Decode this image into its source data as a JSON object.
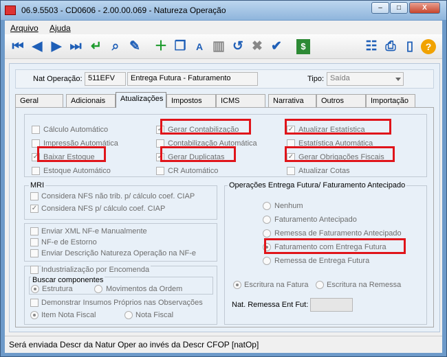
{
  "window": {
    "title": "06.9.5503 - CD0606 - 2.00.00.069 - Natureza Operação",
    "min": "–",
    "max": "□",
    "close": "X"
  },
  "menu": {
    "arquivo": "Arquivo",
    "ajuda": "Ajuda"
  },
  "toolbar": {
    "icons": [
      "first-icon",
      "prev-icon",
      "next-icon",
      "last-icon",
      "enter-icon",
      "zoom-icon",
      "document-edit-icon",
      "new-icon",
      "copy-icon",
      "text-edit-icon",
      "trash-icon",
      "undo-icon",
      "cancel-icon",
      "confirm-icon",
      "dollar-icon",
      "hierarchy-icon",
      "print-icon",
      "exit-icon",
      "help-icon"
    ],
    "dollar": "$",
    "help": "?"
  },
  "header": {
    "nat_label": "Nat Operação:",
    "nat_code": "511EFV",
    "nat_desc": "Entrega Futura - Faturamento",
    "tipo_label": "Tipo:",
    "tipo_value": "Saída"
  },
  "tabs": [
    "Geral",
    "Adicionais",
    "Atualizações",
    "Impostos",
    "ICMS",
    "Narrativa",
    "Outros",
    "Importação"
  ],
  "updates": {
    "calculo": "Cálculo Automático",
    "impressao": "Impressão Automática",
    "baixar": "Baixar Estoque",
    "estoque_auto": "Estoque Automático",
    "gerar_contab": "Gerar Contabilização",
    "contab_auto": "Contabilização Automática",
    "gerar_dup": "Gerar Duplicatas",
    "cr_auto": "CR Automático",
    "atual_estat": "Atualizar Estatística",
    "estat_auto": "Estatística Automática",
    "gerar_obrig": "Gerar Obrigações Fiscais",
    "atual_cotas": "Atualizar Cotas"
  },
  "mri": {
    "title": "MRI",
    "nfs_nao": "Considera NFS não trib. p/ cálculo coef. CIAP",
    "nfs": "Considera NFS p/ cálculo coef. CIAP"
  },
  "nfe": {
    "xml": "Enviar XML NF-e Manualmente",
    "estorno": "NF-e de Estorno",
    "descricao": "Enviar Descrição Natureza Operação na NF-e"
  },
  "indus": {
    "title": "Industrialização por Encomenda",
    "buscar": "Buscar componentes",
    "estrutura": "Estrutura",
    "movimentos": "Movimentos da Ordem",
    "demonstrar": "Demonstrar Insumos Próprios nas Observações",
    "item_nf": "Item Nota Fiscal",
    "nota_fiscal": "Nota Fiscal"
  },
  "oper": {
    "title": "Operações Entrega Futura/ Faturamento Antecipado",
    "nenhum": "Nenhum",
    "fat_antecipado": "Faturamento Antecipado",
    "remessa_fat": "Remessa de Faturamento Antecipado",
    "fat_entrega": "Faturamento com Entrega Futura",
    "remessa_entrega": "Remessa de Entrega Futura",
    "escr_fatura": "Escritura na Fatura",
    "escr_remessa": "Escritura na Remessa",
    "nat_remessa": "Nat. Remessa Ent Fut:"
  },
  "status": "Será enviada Descr da Natur Oper ao invés da Descr CFOP [natOp]",
  "colors": {
    "highlight": "#e0141a",
    "toolbar_blue": "#1f5fb7",
    "title_bg": "#9fc1e3"
  }
}
